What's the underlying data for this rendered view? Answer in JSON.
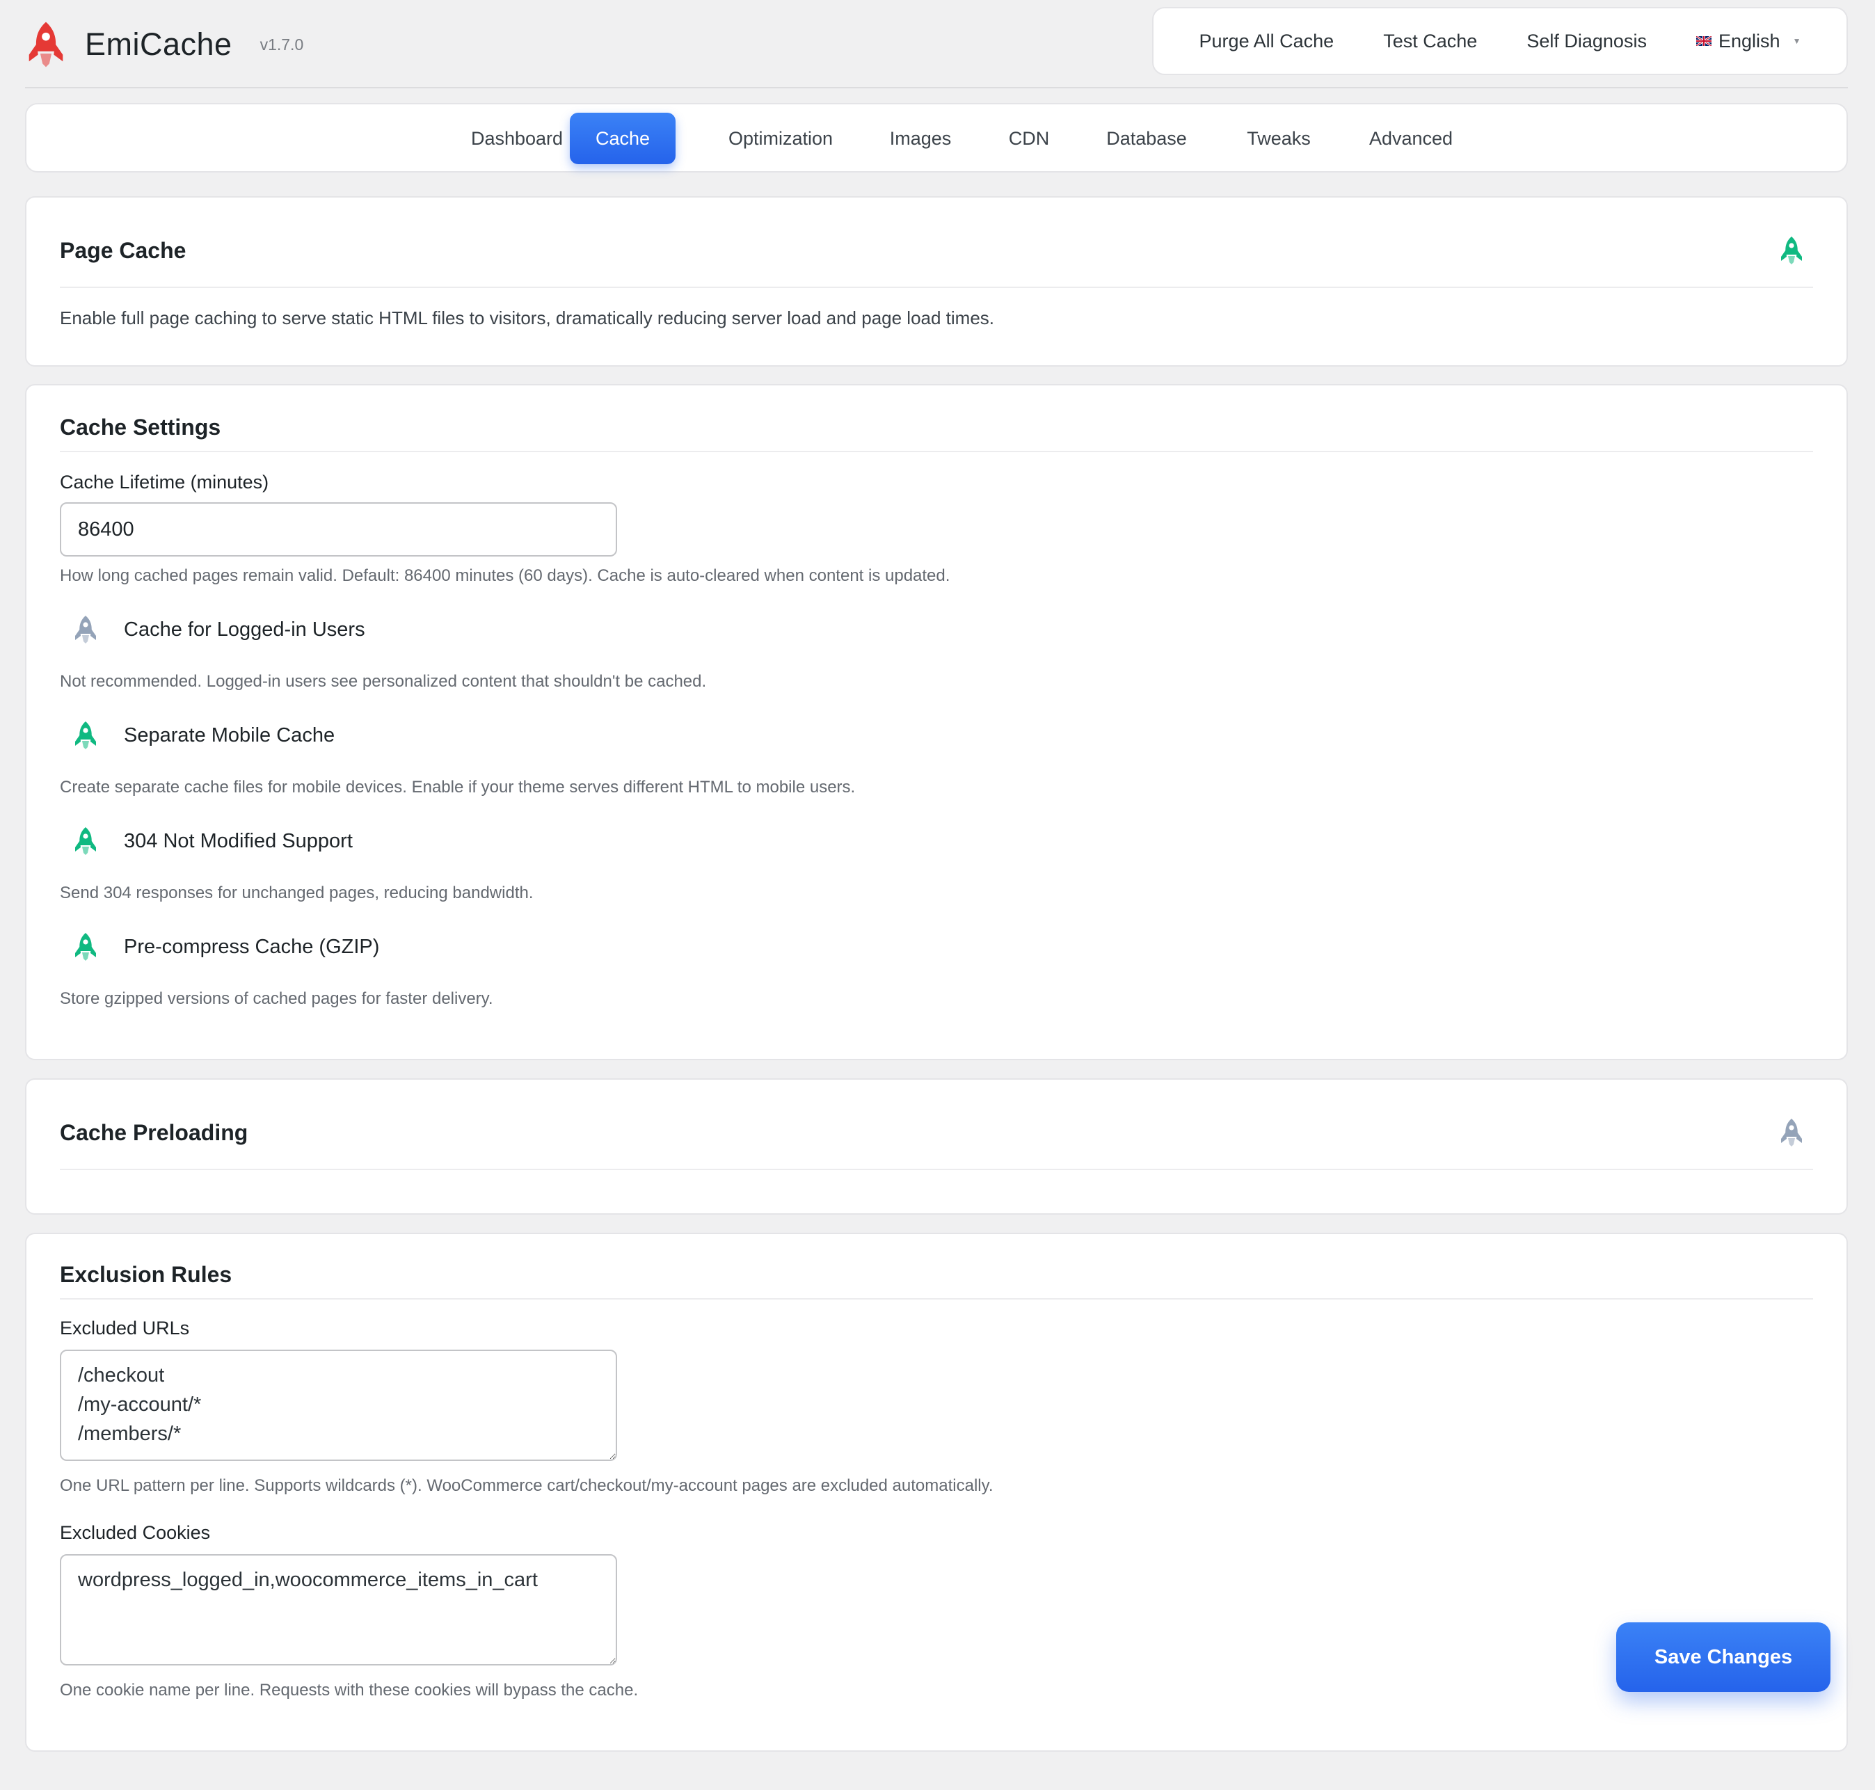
{
  "app": {
    "name": "EmiCache",
    "version": "v1.7.0",
    "brand_color": "#e53935"
  },
  "header": {
    "actions": [
      "Purge All Cache",
      "Test Cache",
      "Self Diagnosis"
    ],
    "language": "English"
  },
  "tabs": [
    {
      "label": "Dashboard",
      "active": false
    },
    {
      "label": "Cache",
      "active": true
    },
    {
      "label": "Optimization",
      "active": false
    },
    {
      "label": "Images",
      "active": false
    },
    {
      "label": "CDN",
      "active": false
    },
    {
      "label": "Database",
      "active": false
    },
    {
      "label": "Tweaks",
      "active": false
    },
    {
      "label": "Advanced",
      "active": false
    }
  ],
  "page_cache": {
    "title": "Page Cache",
    "description": "Enable full page caching to serve static HTML files to visitors, dramatically reducing server load and page load times.",
    "enabled": true
  },
  "cache_settings": {
    "title": "Cache Settings",
    "lifetime_label": "Cache Lifetime (minutes)",
    "lifetime_value": "86400",
    "lifetime_help": "How long cached pages remain valid. Default: 86400 minutes (60 days). Cache is auto-cleared when content is updated.",
    "options": [
      {
        "label": "Cache for Logged-in Users",
        "help": "Not recommended. Logged-in users see personalized content that shouldn't be cached.",
        "enabled": false
      },
      {
        "label": "Separate Mobile Cache",
        "help": "Create separate cache files for mobile devices. Enable if your theme serves different HTML to mobile users.",
        "enabled": true
      },
      {
        "label": "304 Not Modified Support",
        "help": "Send 304 responses for unchanged pages, reducing bandwidth.",
        "enabled": true
      },
      {
        "label": "Pre-compress Cache (GZIP)",
        "help": "Store gzipped versions of cached pages for faster delivery.",
        "enabled": true
      }
    ]
  },
  "cache_preloading": {
    "title": "Cache Preloading",
    "enabled": false
  },
  "exclusion_rules": {
    "title": "Exclusion Rules",
    "urls_label": "Excluded URLs",
    "urls_value": "/checkout\n/my-account/*\n/members/*",
    "urls_help": "One URL pattern per line. Supports wildcards (*). WooCommerce cart/checkout/my-account pages are excluded automatically.",
    "cookies_label": "Excluded Cookies",
    "cookies_value": "wordpress_logged_in,woocommerce_items_in_cart",
    "cookies_help": "One cookie name per line. Requests with these cookies will bypass the cache."
  },
  "save_button": "Save Changes",
  "colors": {
    "accent": "#2563eb",
    "toggle_on": "#10b981",
    "toggle_off": "#94a3b8"
  }
}
